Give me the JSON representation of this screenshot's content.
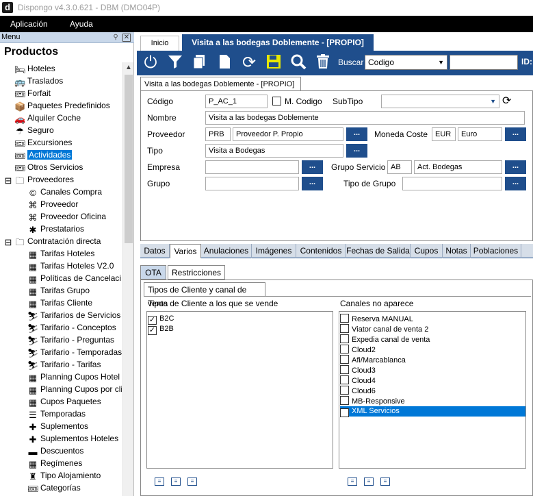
{
  "window": {
    "title": "Dispongo v4.3.0.621 - DBM (DMO04P)",
    "logo": "d"
  },
  "menubar": {
    "items": [
      "Aplicación",
      "Ayuda"
    ]
  },
  "sidebar": {
    "header": "Menu",
    "title": "Productos",
    "items": [
      {
        "label": "Hoteles",
        "icon": "bed-icon",
        "glyph": "🛏",
        "indent": 1
      },
      {
        "label": "Traslados",
        "icon": "bus-icon",
        "glyph": "🚌",
        "indent": 1
      },
      {
        "label": "Forfait",
        "icon": "ticket-icon",
        "glyph": "🎟",
        "indent": 1
      },
      {
        "label": "Paquetes Predefinidos",
        "icon": "box-icon",
        "glyph": "📦",
        "indent": 1
      },
      {
        "label": "Alquiler Coche",
        "icon": "car-icon",
        "glyph": "🚗",
        "indent": 1
      },
      {
        "label": "Seguro",
        "icon": "umbrella-icon",
        "glyph": "☂",
        "indent": 1
      },
      {
        "label": "Excursiones",
        "icon": "ticket-icon",
        "glyph": "🎟",
        "indent": 1
      },
      {
        "label": "Actividades",
        "icon": "ticket-icon",
        "glyph": "🎟",
        "indent": 1,
        "selected": true
      },
      {
        "label": "Otros Servicios",
        "icon": "ticket-icon",
        "glyph": "🎟",
        "indent": 1
      },
      {
        "label": "Proveedores",
        "icon": "folder-icon",
        "glyph": "🗀",
        "indent": 0,
        "expander": "⊟"
      },
      {
        "label": "Canales Compra",
        "icon": "channel-icon",
        "glyph": "©",
        "indent": 2
      },
      {
        "label": "Proveedor",
        "icon": "sitemap-icon",
        "glyph": "⌘",
        "indent": 2
      },
      {
        "label": "Proveedor Oficina",
        "icon": "sitemap-icon",
        "glyph": "⌘",
        "indent": 2
      },
      {
        "label": "Prestatarios",
        "icon": "puzzle-icon",
        "glyph": "✱",
        "indent": 2
      },
      {
        "label": "Contratación directa",
        "icon": "folder-icon",
        "glyph": "🗀",
        "indent": 0,
        "expander": "⊟"
      },
      {
        "label": "Tarifas Hoteles",
        "icon": "calendar-icon",
        "glyph": "▦",
        "indent": 2
      },
      {
        "label": "Tarifas Hoteles V2.0",
        "icon": "calendar-icon",
        "glyph": "▦",
        "indent": 2
      },
      {
        "label": "Políticas de Cancelaci",
        "icon": "calendar-icon",
        "glyph": "▦",
        "indent": 2
      },
      {
        "label": "Tarifas Grupo",
        "icon": "calendar-icon",
        "glyph": "▦",
        "indent": 2
      },
      {
        "label": "Tarifas Cliente",
        "icon": "calendar-icon",
        "glyph": "▦",
        "indent": 2
      },
      {
        "label": "Tarifarios de Servicios",
        "icon": "massage-icon",
        "glyph": "⛷",
        "indent": 2
      },
      {
        "label": "Tarifario - Conceptos",
        "icon": "massage-icon",
        "glyph": "⛷",
        "indent": 2
      },
      {
        "label": "Tarifario - Preguntas",
        "icon": "massage-icon",
        "glyph": "⛷",
        "indent": 2
      },
      {
        "label": "Tarifario - Temporadas",
        "icon": "massage-icon",
        "glyph": "⛷",
        "indent": 2
      },
      {
        "label": "Tarifario - Tarifas",
        "icon": "massage-icon",
        "glyph": "⛷",
        "indent": 2
      },
      {
        "label": "Planning Cupos Hotel",
        "icon": "calendar-icon",
        "glyph": "▦",
        "indent": 2
      },
      {
        "label": "Planning Cupos por cli",
        "icon": "calendar-icon",
        "glyph": "▦",
        "indent": 2
      },
      {
        "label": "Cupos Paquetes",
        "icon": "calendar-icon",
        "glyph": "▦",
        "indent": 2
      },
      {
        "label": "Temporadas",
        "icon": "list-icon",
        "glyph": "☰",
        "indent": 2
      },
      {
        "label": "Suplementos",
        "icon": "plus-icon",
        "glyph": "✚",
        "indent": 2
      },
      {
        "label": "Suplementos Hoteles",
        "icon": "plus-icon",
        "glyph": "✚",
        "indent": 2
      },
      {
        "label": "Descuentos",
        "icon": "minus-icon",
        "glyph": "▬",
        "indent": 2
      },
      {
        "label": "Regímenes",
        "icon": "calendar-icon",
        "glyph": "▦",
        "indent": 2
      },
      {
        "label": "Tipo Alojamiento",
        "icon": "bellhop-icon",
        "glyph": "♜",
        "indent": 2
      },
      {
        "label": "Categorías",
        "icon": "ticket-icon",
        "glyph": "🎟",
        "indent": 2
      }
    ]
  },
  "main": {
    "tabs": {
      "home": "Inicio",
      "active": "Visita a las bodegas Doblemente - [PROPIO]"
    },
    "toolbar": {
      "search_label": "Buscar",
      "search_field": "Codigo",
      "id_label": "ID:"
    },
    "doc_tab": "Visita a las bodegas Doblemente - [PROPIO]",
    "form": {
      "codigo_label": "Código",
      "codigo": "P_AC_1",
      "mcodigo_label": "M. Codigo",
      "subtipo_label": "SubTipo",
      "nombre_label": "Nombre",
      "nombre": "Visita a las bodegas Doblemente",
      "proveedor_label": "Proveedor",
      "proveedor_code": "PRB",
      "proveedor_name": "Proveedor P. Propio",
      "moneda_label": "Moneda Coste",
      "moneda_code": "EUR",
      "moneda_name": "Euro",
      "tipo_label": "Tipo",
      "tipo": "Visita a Bodegas",
      "empresa_label": "Empresa",
      "gruposerv_label": "Grupo Servicio",
      "gruposerv_code": "AB",
      "gruposerv_name": "Act. Bodegas",
      "grupo_label": "Grupo",
      "tipogrupo_label": "Tipo de Grupo",
      "dots": "..."
    },
    "subtabs": [
      "Datos",
      "Varios",
      "Anulaciones",
      "Imágenes",
      "Contenidos",
      "Fechas de Salida",
      "Cupos",
      "Notas",
      "Poblaciones"
    ],
    "inner_tabs": [
      "OTA",
      "Restricciones"
    ],
    "panel_tab": "Tipos de Cliente y canal de venta",
    "clients_title": "Tipos de Cliente a los que se vende",
    "clients": [
      {
        "label": "B2C",
        "checked": true
      },
      {
        "label": "B2B",
        "checked": true
      }
    ],
    "channels_title": "Canales no aparece",
    "channels": [
      {
        "label": "Reserva MANUAL",
        "checked": false
      },
      {
        "label": "Viator canal de venta 2",
        "checked": false
      },
      {
        "label": "Expedia canal de venta",
        "checked": false
      },
      {
        "label": "Cloud2",
        "checked": false
      },
      {
        "label": "Afi/Marcablanca",
        "checked": false
      },
      {
        "label": "Cloud3",
        "checked": false
      },
      {
        "label": "Cloud4",
        "checked": false
      },
      {
        "label": "Cloud6",
        "checked": false
      },
      {
        "label": "MB-Responsive",
        "checked": false
      },
      {
        "label": "XML Servicios",
        "checked": true,
        "selected": true
      }
    ]
  }
}
